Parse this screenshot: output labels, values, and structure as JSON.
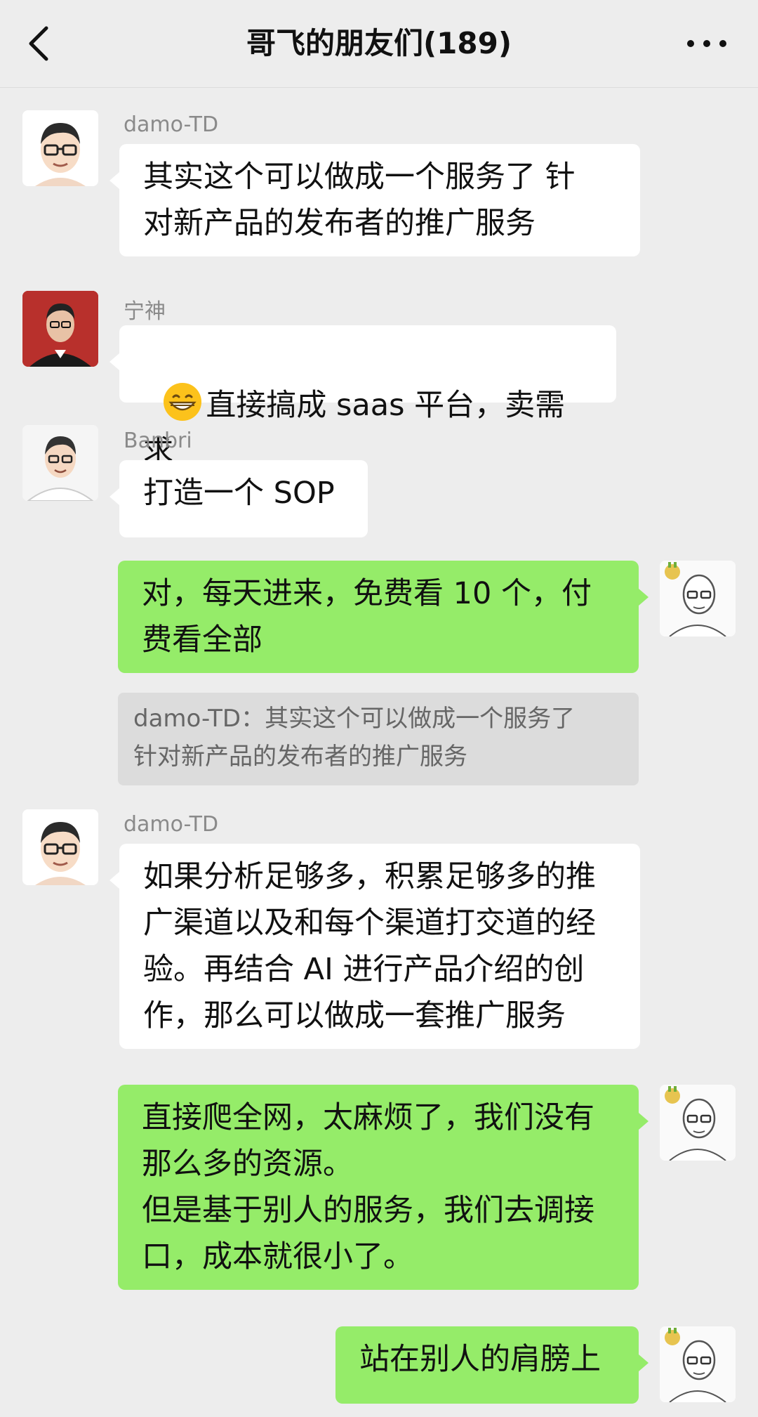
{
  "header": {
    "title": "哥飞的朋友们(189)",
    "back_icon": "chevron-left-icon",
    "more_icon": "more-dots-icon"
  },
  "messages": [
    {
      "sender": "damo-TD",
      "direction": "incoming",
      "text": "其实这个可以做成一个服务了 针\n对新产品的发布者的推广服务"
    },
    {
      "sender": "宁神",
      "direction": "incoming",
      "emoji": "grinning-face-emoji",
      "text": "直接搞成 saas 平台，卖需求"
    },
    {
      "sender": "Banbri",
      "direction": "incoming",
      "text": "打造一个 SOP"
    },
    {
      "sender": "",
      "direction": "outgoing",
      "text": "对，每天进来，免费看 10 个，付\n费看全部",
      "quote": "damo-TD：其实这个可以做成一个服务了\n针对新产品的发布者的推广服务"
    },
    {
      "sender": "damo-TD",
      "direction": "incoming",
      "text": "如果分析足够多，积累足够多的推\n广渠道以及和每个渠道打交道的经\n验。再结合 AI 进行产品介绍的创\n作，那么可以做成一套推广服务"
    },
    {
      "sender": "",
      "direction": "outgoing",
      "text": "直接爬全网，太麻烦了，我们没有\n那么多的资源。\n但是基于别人的服务，我们去调接\n口，成本就很小了。"
    },
    {
      "sender": "",
      "direction": "outgoing",
      "text": "站在别人的肩膀上"
    }
  ],
  "colors": {
    "background": "#ededed",
    "incoming_bubble": "#ffffff",
    "outgoing_bubble": "#95ec69",
    "quote_bg": "#dcdcdc"
  }
}
